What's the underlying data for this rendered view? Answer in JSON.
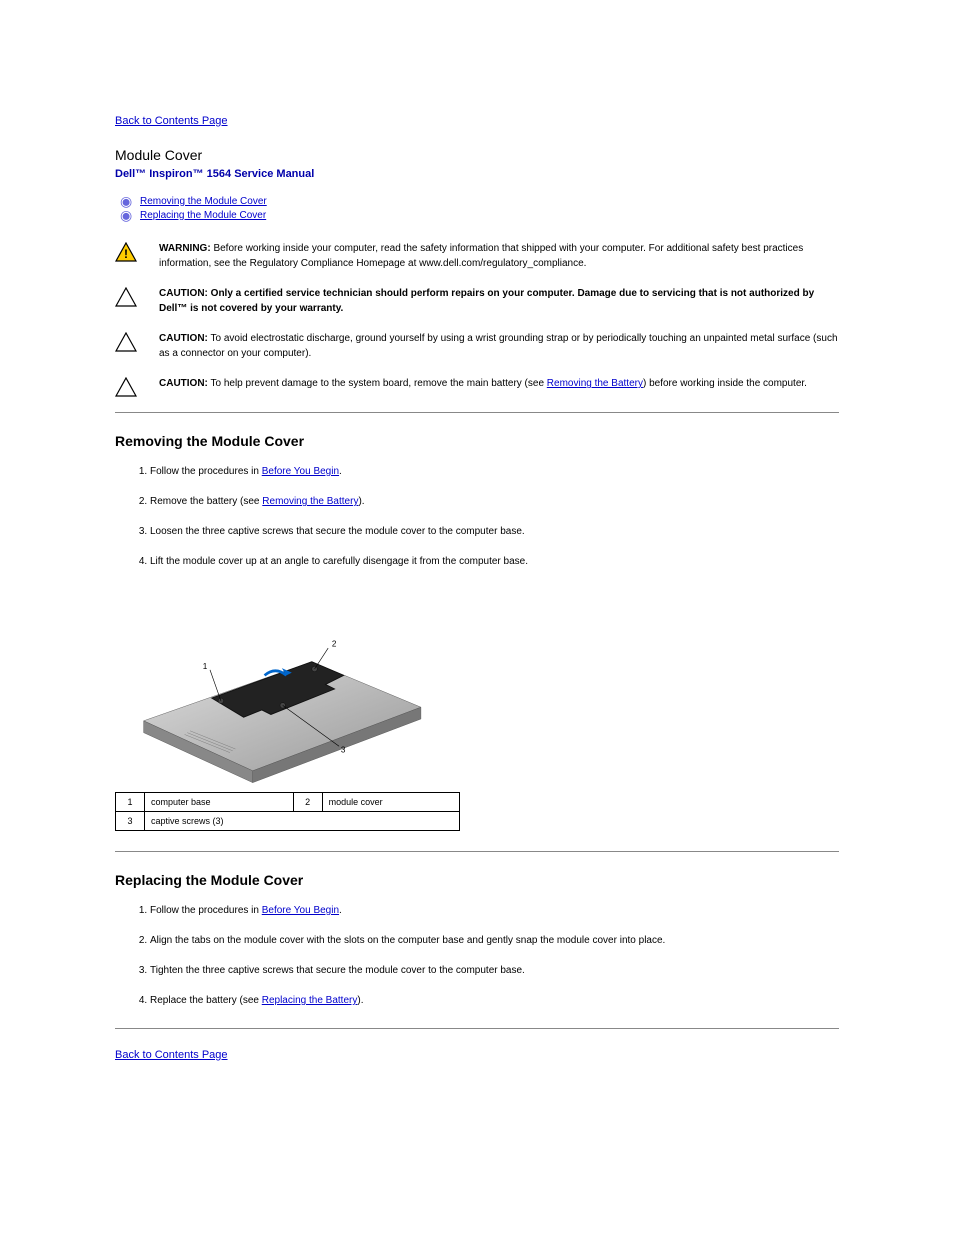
{
  "nav_top": "Back to Contents Page",
  "page_title": "Module Cover",
  "manual_name": "Dell™ Inspiron™ 1564 Service Manual",
  "toc": [
    "Removing the Module Cover",
    "Replacing the Module Cover"
  ],
  "warnings": [
    {
      "label": "WARNING:",
      "fill": "#ffcc00",
      "stroke": "#000",
      "text_before": "Before working inside your computer, read the safety information that shipped with your computer. For additional safety best practices information, see the Regulatory Compliance Homepage at www.dell.com/regulatory_compliance."
    },
    {
      "label": "CAUTION:",
      "fill": "none",
      "stroke": "#000",
      "text_before": "Only a certified service technician should perform repairs on your computer. Damage due to servicing that is not authorized by Dell™ is not covered by your warranty."
    },
    {
      "label": "CAUTION:",
      "fill": "none",
      "stroke": "#000",
      "text_before": "To avoid electrostatic discharge, ground yourself by using a wrist grounding strap or by periodically touching an unpainted metal surface (such as a connector on your computer)."
    },
    {
      "label": "CAUTION:",
      "fill": "none",
      "stroke": "#000",
      "prefix": "To help prevent damage to the system board, remove the main battery (see ",
      "link": "Removing the Battery",
      "suffix": ") before working inside the computer."
    }
  ],
  "section1": {
    "heading": "Removing the Module Cover",
    "steps": [
      {
        "text_before": "Follow the procedures in ",
        "link": "Before You Begin",
        "text_after": "."
      },
      {
        "text_before": "Remove the battery (see ",
        "link": "Removing the Battery",
        "text_after": ")."
      },
      {
        "text_plain": "Loosen the three captive screws that secure the module cover to the computer base."
      },
      {
        "text_plain": "Lift the module cover up at an angle to carefully disengage it from the computer base."
      }
    ]
  },
  "legend": [
    {
      "n": "1",
      "label": "computer base"
    },
    {
      "n": "2",
      "label": "module cover"
    },
    {
      "n": "3",
      "label": "captive screws (3)"
    }
  ],
  "section2": {
    "heading": "Replacing the Module Cover",
    "steps": [
      {
        "text_before": "Follow the procedures in ",
        "link": "Before You Begin",
        "text_after": "."
      },
      {
        "text_plain": "Align the tabs on the module cover with the slots on the computer base and gently snap the module cover into place."
      },
      {
        "text_plain": "Tighten the three captive screws that secure the module cover to the computer base."
      },
      {
        "text_before": "Replace the battery (see ",
        "link": "Replacing the Battery",
        "text_after": ")."
      }
    ]
  },
  "nav_bottom": "Back to Contents Page",
  "diagram": {
    "labels": {
      "l1": "1",
      "l2": "2",
      "l3": "3"
    }
  }
}
